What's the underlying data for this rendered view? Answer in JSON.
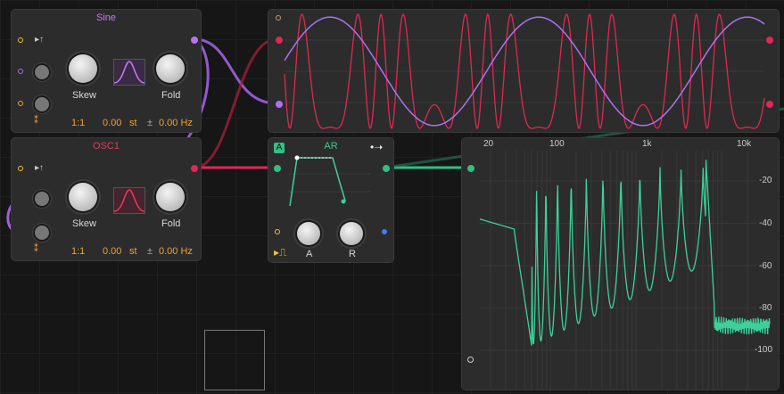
{
  "sine_module": {
    "title": "Sine",
    "skew_label": "Skew",
    "fold_label": "Fold",
    "ratio": "1:1",
    "semitones": "0.00",
    "semitone_unit": "st",
    "pm_symbol": "±",
    "hz_offset": "0.00 Hz",
    "title_color": "#c07cf0"
  },
  "osc1_module": {
    "title": "OSC1",
    "skew_label": "Skew",
    "fold_label": "Fold",
    "ratio": "1:1",
    "semitones": "0.00",
    "semitone_unit": "st",
    "pm_symbol": "±",
    "hz_offset": "0.00 Hz",
    "title_color": "#e83a5a"
  },
  "ar_module": {
    "title": "AR",
    "badge": "A",
    "attack_label": "A",
    "release_label": "R",
    "title_color": "#40c890"
  },
  "spectrum": {
    "freq_ticks": [
      "20",
      "100",
      "1k",
      "10k"
    ],
    "db_ticks": [
      "-20",
      "-40",
      "-60",
      "-80",
      "-100"
    ],
    "line_color": "#3ed09a"
  },
  "colors": {
    "sine": "#b070f0",
    "osc": "#e02850",
    "green": "#30c080",
    "accent_orange": "#f0a030"
  }
}
